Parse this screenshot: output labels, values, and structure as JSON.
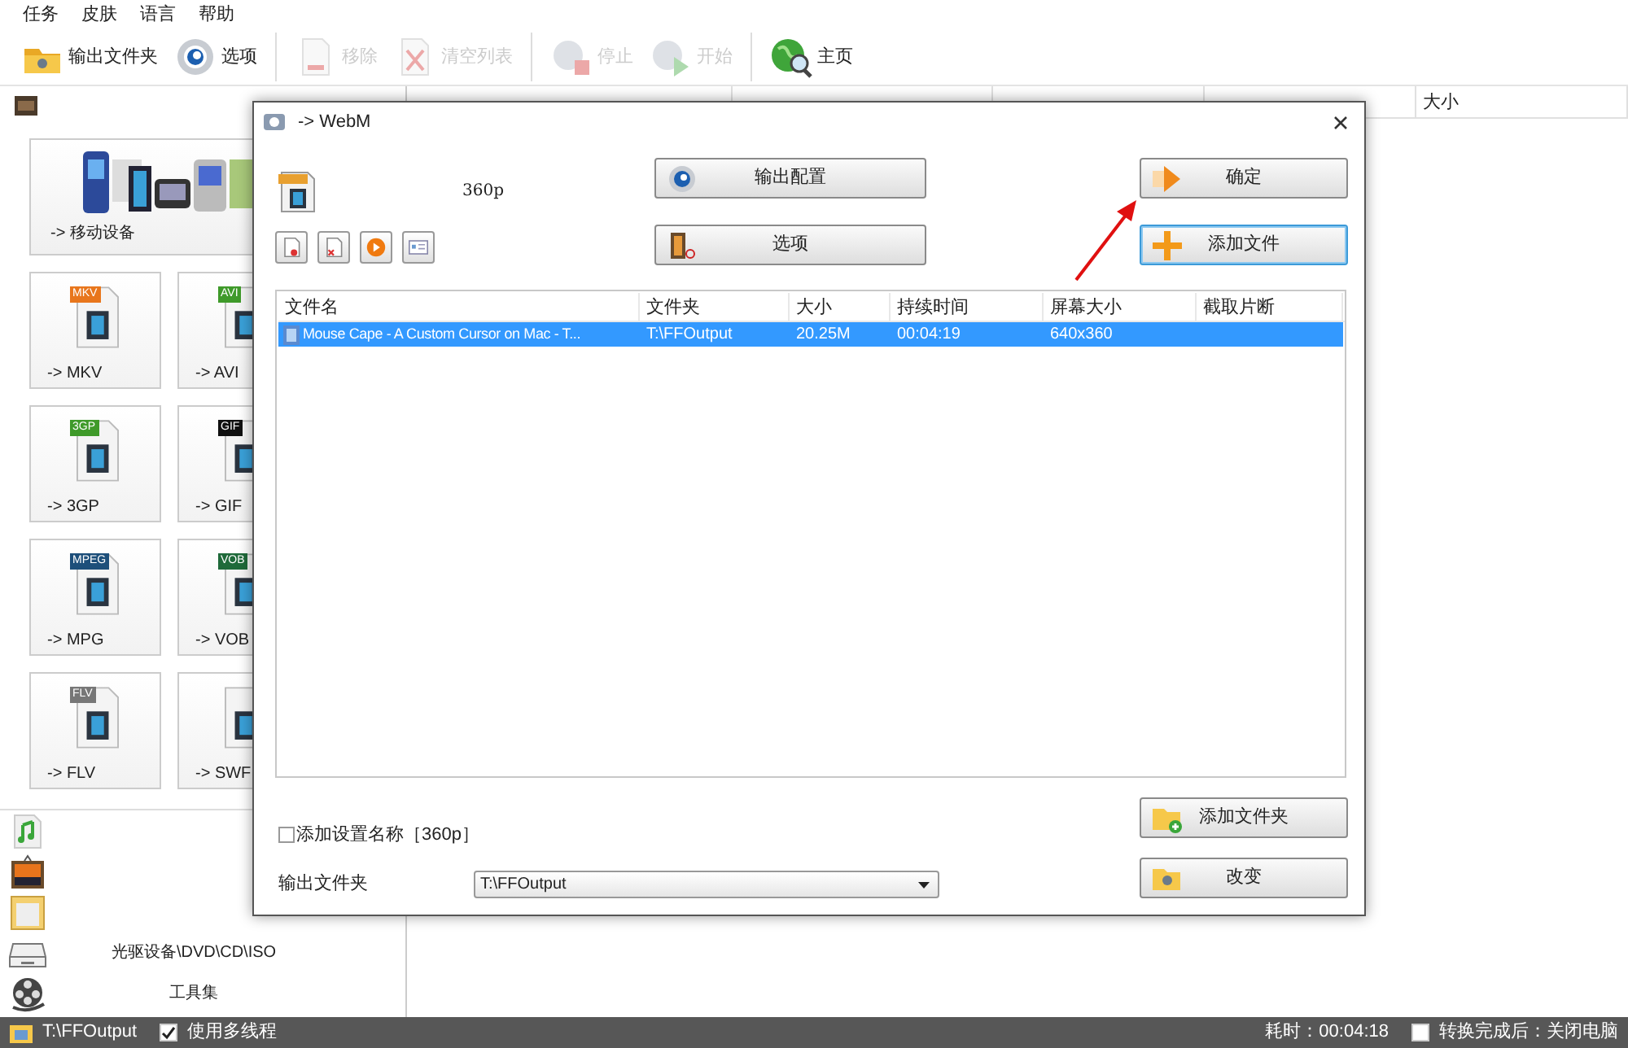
{
  "menu": [
    "任务",
    "皮肤",
    "语言",
    "帮助"
  ],
  "toolbar": [
    {
      "label": "输出文件夹",
      "disabled": false
    },
    {
      "label": "选项",
      "disabled": false
    },
    {
      "label": "移除",
      "disabled": true
    },
    {
      "label": "清空列表",
      "disabled": true
    },
    {
      "label": "停止",
      "disabled": true
    },
    {
      "label": "开始",
      "disabled": true
    },
    {
      "label": "主页",
      "disabled": false
    }
  ],
  "formats": [
    {
      "kind": "wide",
      "label": "-> 移动设备"
    },
    {
      "kind": "tile",
      "label": "-> MKV",
      "badge": "MKV"
    },
    {
      "kind": "tile",
      "label": "-> AVI",
      "badge": "AVI"
    },
    {
      "kind": "tile",
      "label": "-> 3GP",
      "badge": "3GP"
    },
    {
      "kind": "tile",
      "label": "-> GIF",
      "badge": "GIF"
    },
    {
      "kind": "tile",
      "label": "-> MPG",
      "badge": "MPEG"
    },
    {
      "kind": "tile",
      "label": "-> VOB",
      "badge": "VOB"
    },
    {
      "kind": "tile",
      "label": "-> FLV",
      "badge": "FLV"
    },
    {
      "kind": "tile",
      "label": "-> SWF"
    }
  ],
  "categories": [
    {
      "label": "光驱设备\\DVD\\CD\\ISO"
    },
    {
      "label": "工具集"
    }
  ],
  "task_table": {
    "columns": [
      "大小"
    ]
  },
  "dialog": {
    "title": "-> WebM",
    "preset": "360p",
    "buttons": [
      {
        "label": "输出配置",
        "focused": false
      },
      {
        "label": "选项",
        "focused": false
      },
      {
        "label": "确定",
        "focused": false
      },
      {
        "label": "添加文件",
        "focused": true
      }
    ],
    "file_table": {
      "columns": [
        "文件名",
        "文件夹",
        "大小",
        "持续时间",
        "屏幕大小",
        "截取片断"
      ],
      "rows": [
        {
          "selected": true,
          "cells": [
            "Mouse Cape - A Custom Cursor on Mac - T...",
            "T:\\FFOutput",
            "20.25M",
            "00:04:19",
            "640x360"
          ]
        }
      ]
    },
    "add_setting_name": {
      "label": "添加设置名称［360p］",
      "checked": false
    },
    "output_folder": {
      "label": "输出文件夹",
      "value": "T:\\FFOutput"
    },
    "bottom_buttons": [
      {
        "label": "添加文件夹"
      },
      {
        "label": "改变"
      }
    ]
  },
  "status_bar": {
    "folder": "T:\\FFOutput",
    "multithread": {
      "label": "使用多线程",
      "checked": true
    },
    "elapsed": "耗时：00:04:18",
    "shutdown": {
      "label": "转换完成后：关闭电脑",
      "checked": false
    }
  }
}
